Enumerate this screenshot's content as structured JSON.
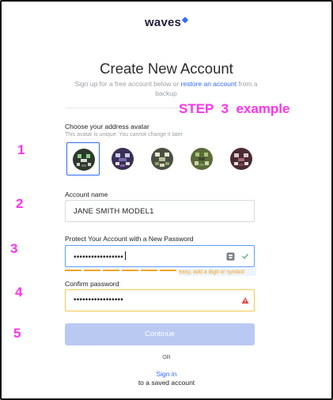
{
  "brand": {
    "logo_text": "waves",
    "logo_mark": "◆"
  },
  "page": {
    "title": "Create New Account",
    "subtitle_before": "Sign up for a free account below or ",
    "subtitle_link": "restore an account",
    "subtitle_after": " from a backup"
  },
  "annotation": {
    "step": "STEP  3  example",
    "markers": [
      "1",
      "2",
      "3",
      "4",
      "5"
    ]
  },
  "avatar": {
    "label": "Choose your address avatar",
    "hint": "This avatar is unique. You cannot change it later",
    "selected_index": 0
  },
  "account": {
    "label": "Account name",
    "value": "JANE SMITH MODEL1"
  },
  "password": {
    "label": "Protect Your Account with a New Password",
    "value": "•••••••••••••••••",
    "strength_hint": "easy, add a digit or symbol",
    "strength_segments": 7
  },
  "confirm": {
    "label": "Confirm password",
    "value": "•••••••••••••••••"
  },
  "actions": {
    "continue_label": "Continue",
    "or_label": "OR",
    "signin_label": "Sign in",
    "signin_sub": "to a saved account"
  },
  "colors": {
    "accent": "#2f6bff",
    "annotation": "#ff33ee",
    "warning": "#f0a31a",
    "button_disabled": "#b9c9f2"
  }
}
